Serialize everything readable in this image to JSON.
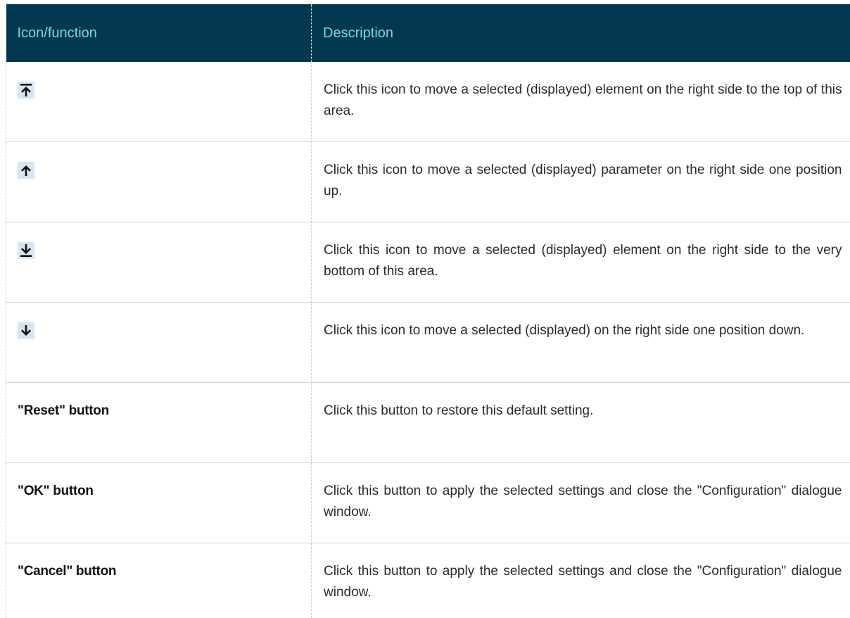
{
  "table": {
    "headers": {
      "function": "Icon/function",
      "description": "Description"
    },
    "rows": [
      {
        "icon": "move-to-top-icon",
        "label": "",
        "description": "Click this icon to move a selected (displayed) element on the right side to the top of this area."
      },
      {
        "icon": "move-up-icon",
        "label": "",
        "description": "Click this icon to move a selected (displayed) parameter on the right side one position up."
      },
      {
        "icon": "move-to-bottom-icon",
        "label": "",
        "description": "Click this icon to move a selected (displayed) element on the right side to the very bottom of this area."
      },
      {
        "icon": "move-down-icon",
        "label": "",
        "description": "Click this icon to move a selected (displayed) on the right side one position down."
      },
      {
        "icon": "",
        "label": "\"Reset\" button",
        "description": "Click this button to restore this default setting."
      },
      {
        "icon": "",
        "label": "\"OK\" button",
        "description": "Click this button to apply the selected settings and close the \"Configuration\" dialogue window."
      },
      {
        "icon": "",
        "label": "\"Cancel\" button",
        "description": "Click this button to apply the selected settings and close the \"Configuration\" dialogue window."
      }
    ]
  },
  "colors": {
    "header_bg": "#02384f",
    "header_text": "#7fd3ee",
    "icon_bg": "#d6e6f2"
  }
}
